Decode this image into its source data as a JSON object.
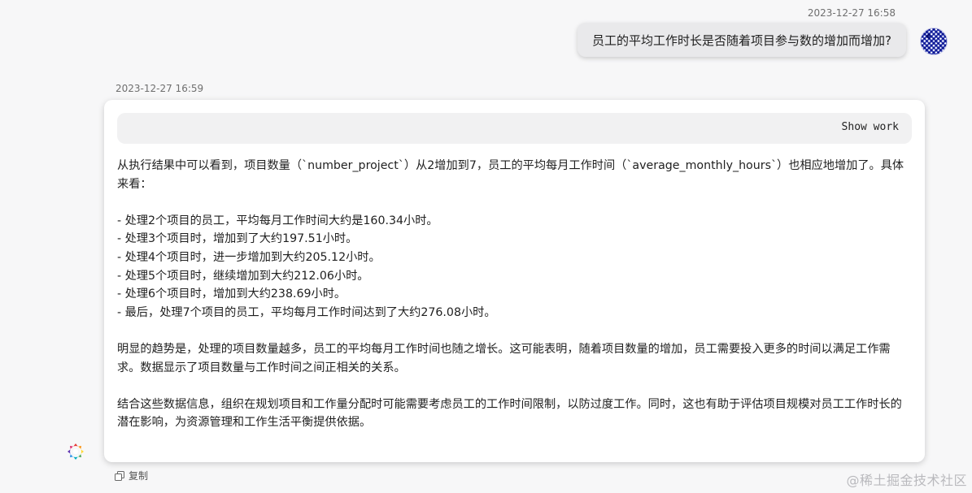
{
  "user_message": {
    "timestamp": "2023-12-27 16:58",
    "text": "员工的平均工作时长是否随着项目参与数的增加而增加?",
    "avatar_icon": "user-avatar-pattern"
  },
  "assistant_message": {
    "timestamp": "2023-12-27 16:59",
    "show_work_label": "Show work",
    "paragraphs": [
      "从执行结果中可以看到，项目数量（`number_project`）从2增加到7，员工的平均每月工作时间（`average_monthly_hours`）也相应地增加了。具体来看：",
      "",
      "- 处理2个项目的员工，平均每月工作时间大约是160.34小时。",
      "- 处理3个项目时，增加到了大约197.51小时。",
      "- 处理4个项目时，进一步增加到大约205.12小时。",
      "- 处理5个项目时，继续增加到大约212.06小时。",
      "- 处理6个项目时，增加到大约238.69小时。",
      "- 最后，处理7个项目的员工，平均每月工作时间达到了大约276.08小时。",
      "",
      "明显的趋势是，处理的项目数量越多，员工的平均每月工作时间也随之增长。这可能表明，随着项目数量的增加，员工需要投入更多的时间以满足工作需求。数据显示了项目数量与工作时间之间正相关的关系。",
      "",
      "结合这些数据信息，组织在规划项目和工作量分配时可能需要考虑员工的工作时间限制，以防过度工作。同时，这也有助于评估项目规模对员工工作时长的潜在影响，为资源管理和工作生活平衡提供依据。"
    ],
    "copy_label": "复制",
    "avatar_icon": "assistant-logo"
  },
  "watermark": "@稀土掘金技术社区"
}
